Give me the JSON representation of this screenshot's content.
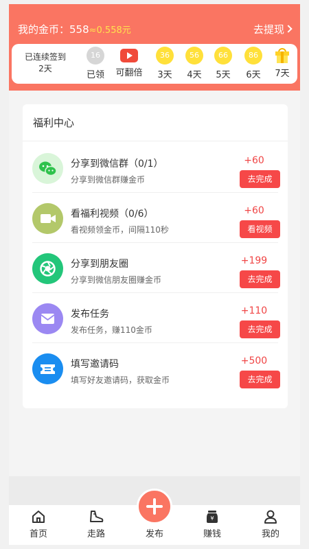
{
  "header": {
    "coin_label": "我的金币：558",
    "coin_value_yuan": "≈0.558元",
    "withdraw_label": "去提现"
  },
  "signin": {
    "streak_label": "已连续签到",
    "streak_days": "2天",
    "days": [
      {
        "number": "16",
        "label": "已领"
      },
      {
        "number": "",
        "label": "可翻倍"
      },
      {
        "number": "36",
        "label": "3天"
      },
      {
        "number": "56",
        "label": "4天"
      },
      {
        "number": "66",
        "label": "5天"
      },
      {
        "number": "86",
        "label": "6天"
      },
      {
        "number": "",
        "label": "7天"
      }
    ]
  },
  "welfare": {
    "title": "福利中心",
    "tasks": [
      {
        "name": "分享到微信群（0/1）",
        "desc": "分享到微信群赚金币",
        "reward": "+60",
        "button": "去完成",
        "icon": "wechat-icon",
        "color": "#2fc24c"
      },
      {
        "name": "看福利视频（0/6）",
        "desc": "看视频领金币，间隔110秒",
        "reward": "+60",
        "button": "看视频",
        "icon": "video-camera-icon",
        "color": "#a9c25a"
      },
      {
        "name": "分享到朋友圈",
        "desc": "分享到微信朋友圈赚金币",
        "reward": "+199",
        "button": "去完成",
        "icon": "moments-icon",
        "color": "#23c67a"
      },
      {
        "name": "发布任务",
        "desc": "发布任务，赚110金币",
        "reward": "+110",
        "button": "去完成",
        "icon": "task-envelope-icon",
        "color": "#9b88f2"
      },
      {
        "name": "填写邀请码",
        "desc": "填写好友邀请码，获取金币",
        "reward": "+500",
        "button": "去完成",
        "icon": "ticket-icon",
        "color": "#1a8df0"
      }
    ]
  },
  "tabbar": {
    "items": [
      {
        "label": "首页",
        "icon": "home-icon"
      },
      {
        "label": "走路",
        "icon": "shoe-icon"
      },
      {
        "label": "发布",
        "icon": "plus-icon"
      },
      {
        "label": "赚钱",
        "icon": "money-jar-icon"
      },
      {
        "label": "我的",
        "icon": "user-icon"
      }
    ]
  },
  "colors": {
    "brand": "#fa7562",
    "action": "#f64848",
    "coin": "#ffe03a"
  }
}
